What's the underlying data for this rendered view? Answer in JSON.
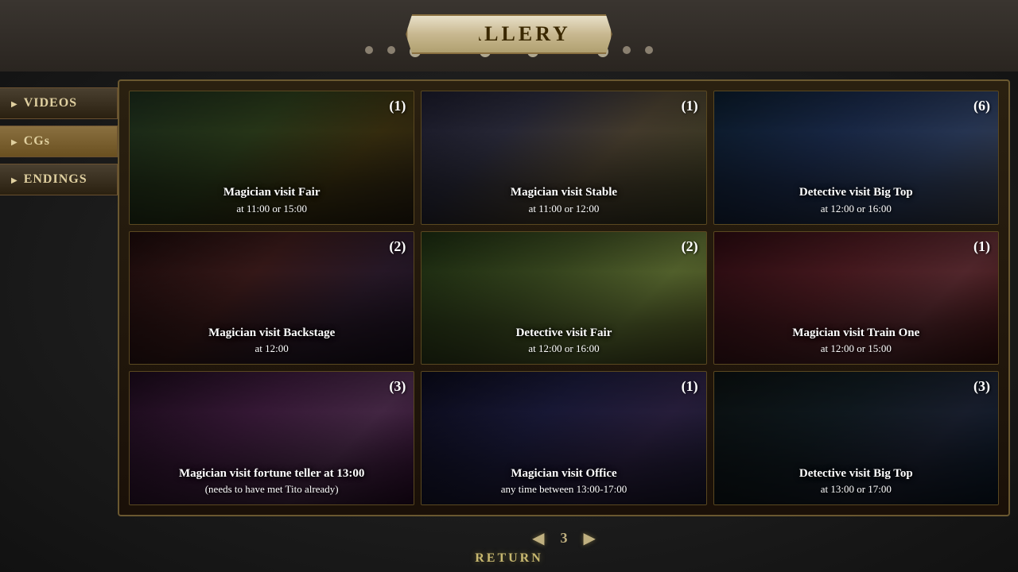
{
  "header": {
    "title": "GALLERY"
  },
  "sidebar": {
    "items": [
      {
        "id": "videos",
        "label": "VIDEOS",
        "active": false
      },
      {
        "id": "cgs",
        "label": "CGs",
        "active": true
      },
      {
        "id": "endings",
        "label": "ENDINGS",
        "active": false
      }
    ]
  },
  "gallery": {
    "cells": [
      {
        "id": 1,
        "number": "(1)",
        "title": "Magician visit Fair",
        "subtitle": "at 11:00 or 15:00",
        "bgClass": "cell-1"
      },
      {
        "id": 2,
        "number": "(1)",
        "title": "Magician visit Stable",
        "subtitle": "at 11:00 or 12:00",
        "bgClass": "cell-2"
      },
      {
        "id": 3,
        "number": "(6)",
        "title": "Detective visit Big Top",
        "subtitle": "at 12:00 or 16:00",
        "bgClass": "cell-3"
      },
      {
        "id": 4,
        "number": "(2)",
        "title": "Magician visit Backstage",
        "subtitle": "at 12:00",
        "bgClass": "cell-4"
      },
      {
        "id": 5,
        "number": "(2)",
        "title": "Detective visit Fair",
        "subtitle": "at 12:00 or 16:00",
        "bgClass": "cell-5"
      },
      {
        "id": 6,
        "number": "(1)",
        "title": "Magician visit Train One",
        "subtitle": "at 12:00 or 15:00",
        "bgClass": "cell-6"
      },
      {
        "id": 7,
        "number": "(3)",
        "title": "Magician visit fortune teller at 13:00",
        "subtitle": "(needs to have met Tito already)",
        "bgClass": "cell-7"
      },
      {
        "id": 8,
        "number": "(1)",
        "title": "Magician visit Office",
        "subtitle": "any time between 13:00-17:00",
        "bgClass": "cell-8"
      },
      {
        "id": 9,
        "number": "(3)",
        "title": "Detective visit Big Top",
        "subtitle": "at 13:00 or 17:00",
        "bgClass": "cell-9"
      }
    ],
    "page": "3"
  },
  "pagination": {
    "prev": "◀",
    "next": "▶",
    "current": "3"
  },
  "footer": {
    "return_label": "RETURN"
  }
}
